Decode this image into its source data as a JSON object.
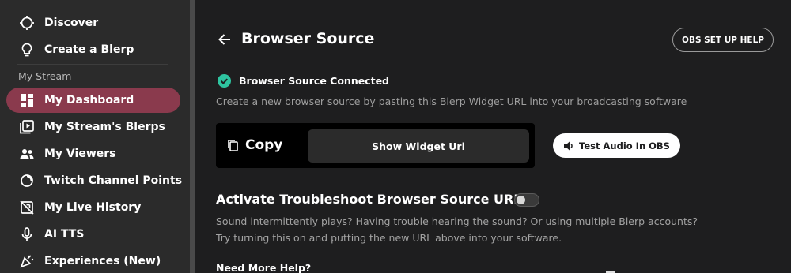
{
  "sidebar": {
    "items": [
      {
        "label": "Discover",
        "icon": "compass-icon"
      },
      {
        "label": "Create a Blerp",
        "icon": "lightbulb-icon"
      },
      {
        "label": "My Dashboard",
        "icon": "dashboard-icon",
        "active": true
      },
      {
        "label": "My Stream's Blerps",
        "icon": "video-library-icon"
      },
      {
        "label": "My Viewers",
        "icon": "people-icon"
      },
      {
        "label": "Twitch Channel Points",
        "icon": "channel-points-icon"
      },
      {
        "label": "My Live History",
        "icon": "live-history-icon"
      },
      {
        "label": "AI TTS",
        "icon": "microphone-icon"
      },
      {
        "label": "Experiences (New)",
        "icon": "party-popper-icon"
      }
    ],
    "section_label": "My Stream",
    "active_color": "#8a3a4d"
  },
  "header": {
    "title": "Browser Source",
    "help_button": "OBS SET UP HELP"
  },
  "status": {
    "text": "Browser Source Connected",
    "color": "#2ec4a0"
  },
  "description": "Create a new browser source by pasting this Blerp Widget URL into your broadcasting software",
  "widget": {
    "copy_label": "Copy",
    "show_url_label": "Show Widget Url",
    "test_audio_label": "Test Audio In OBS"
  },
  "troubleshoot": {
    "title": "Activate Troubleshoot Browser Source URL",
    "enabled": false,
    "line1": "Sound intermittently plays? Having trouble hearing the sound? Or using multiple Blerp accounts?",
    "line2": "Try turning this on and putting the new URL above into your software."
  },
  "need_help": "Need More Help?"
}
